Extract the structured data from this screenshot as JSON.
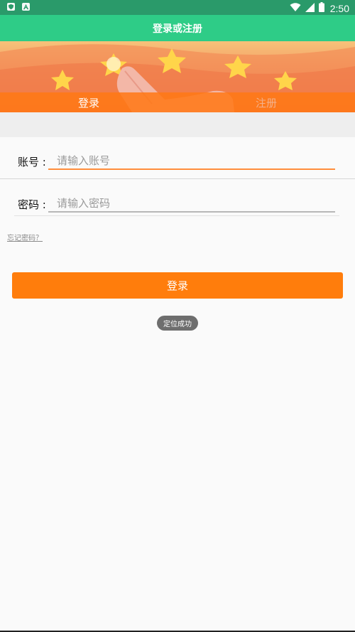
{
  "status_bar": {
    "time": "2:50",
    "left_icons": [
      "shield-icon",
      "a-letter-icon"
    ],
    "right_icons": [
      "wifi-icon",
      "signal-icon",
      "battery-icon"
    ]
  },
  "header": {
    "title": "登录或注册"
  },
  "tabs": [
    {
      "label": "登录",
      "active": true
    },
    {
      "label": "注册",
      "active": false
    }
  ],
  "form": {
    "account": {
      "label": "账号 :",
      "placeholder": "请输入账号",
      "value": ""
    },
    "password": {
      "label": "密码 :",
      "placeholder": "请输入密码",
      "value": ""
    },
    "forgot_link": "忘记密码？",
    "submit_label": "登录"
  },
  "toast": {
    "text": "定位成功"
  },
  "colors": {
    "status_bar": "#2a9a6a",
    "title_bar": "#2ecc87",
    "accent_orange": "#ff7d0c",
    "input_active_line": "#ff8d3b"
  }
}
